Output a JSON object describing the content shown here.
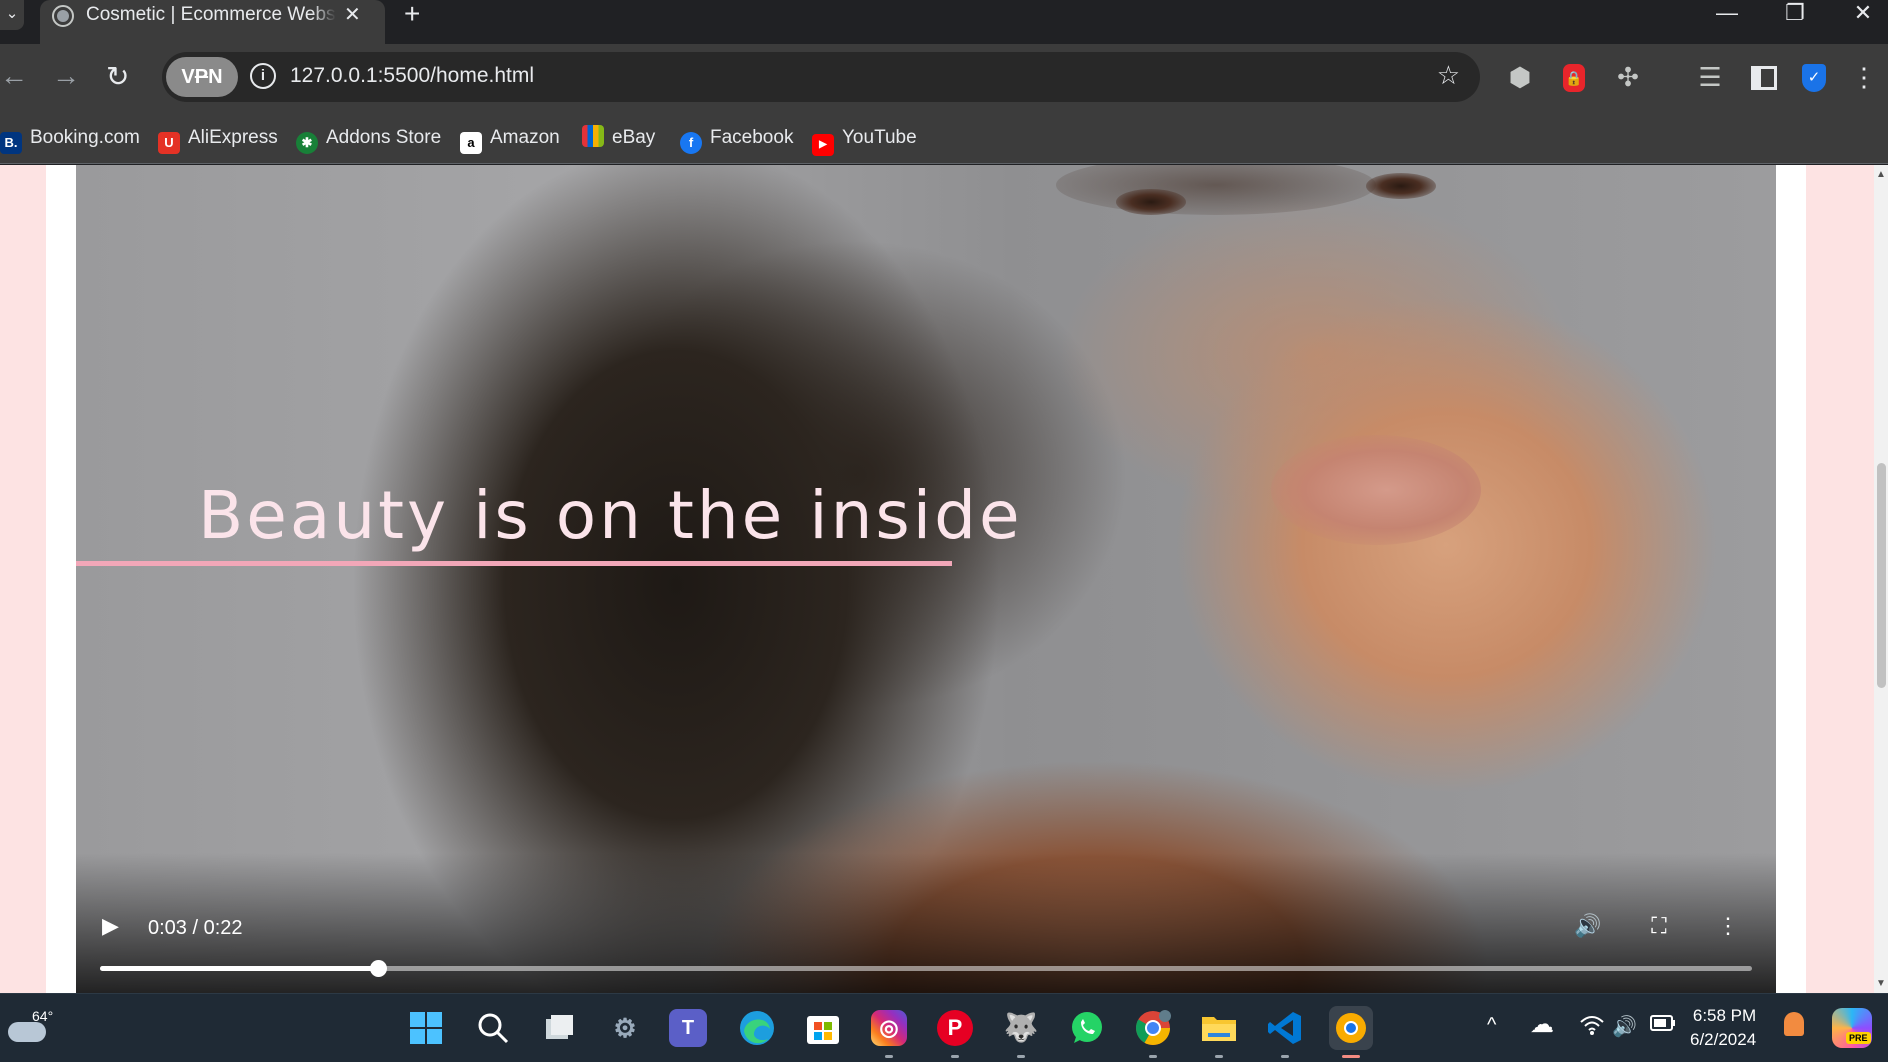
{
  "browser": {
    "tab": {
      "title": "Cosmetic | Ecommerce Website",
      "close": "✕"
    },
    "new_tab": "+",
    "window": {
      "minimize": "—",
      "restore": "❐",
      "close": "✕"
    },
    "nav": {
      "back": "←",
      "forward": "→",
      "reload": "↻"
    },
    "vpn_label": "VPN",
    "info_icon": "i",
    "url": "127.0.0.1:5500/home.html",
    "star": "☆",
    "extensions": [
      "shield-extension",
      "password-manager-extension",
      "extensions-puzzle",
      "reading-list",
      "side-panel",
      "security-shield"
    ],
    "menu": "⋮"
  },
  "bookmarks": [
    {
      "label": "Booking.com",
      "icon": "B.",
      "color": "#003580"
    },
    {
      "label": "AliExpress",
      "icon": "U",
      "color": "#e43225"
    },
    {
      "label": "Addons Store",
      "icon": "✱",
      "color": "#188038"
    },
    {
      "label": "Amazon",
      "icon": "a",
      "color": "#ffffff"
    },
    {
      "label": "eBay",
      "icon": "▰",
      "color": "#e53238"
    },
    {
      "label": "Facebook",
      "icon": "f",
      "color": "#1877f2"
    },
    {
      "label": "YouTube",
      "icon": "▶",
      "color": "#ff0000"
    }
  ],
  "page": {
    "background_color": "#fde3e3",
    "accent_color": "#f2a7b8",
    "video": {
      "headline": "Beauty is on the inside",
      "time_display": "0:03 / 0:22",
      "progress_fraction": 0.168,
      "play_icon": "▶",
      "volume_icon": "🔊",
      "fullscreen_icon": "⛶",
      "more_icon": "⋮"
    }
  },
  "taskbar": {
    "weather_temp": "64°",
    "apps": [
      "start",
      "search",
      "task-view",
      "settings",
      "teams",
      "edge",
      "store",
      "instagram",
      "pinterest",
      "wasteland-app",
      "whatsapp",
      "chrome",
      "file-explorer",
      "vscode",
      "chrome-canary"
    ],
    "labels": {
      "teams": "T",
      "store": "▦",
      "instagram": "◎",
      "pinterest": "P"
    },
    "tray": {
      "chevron": "^",
      "cloud": "☁",
      "wifi": "᯾",
      "volume": "🔊",
      "battery": "▭"
    },
    "time": "6:58 PM",
    "date": "6/2/2024",
    "copilot_badge": "PRE"
  }
}
